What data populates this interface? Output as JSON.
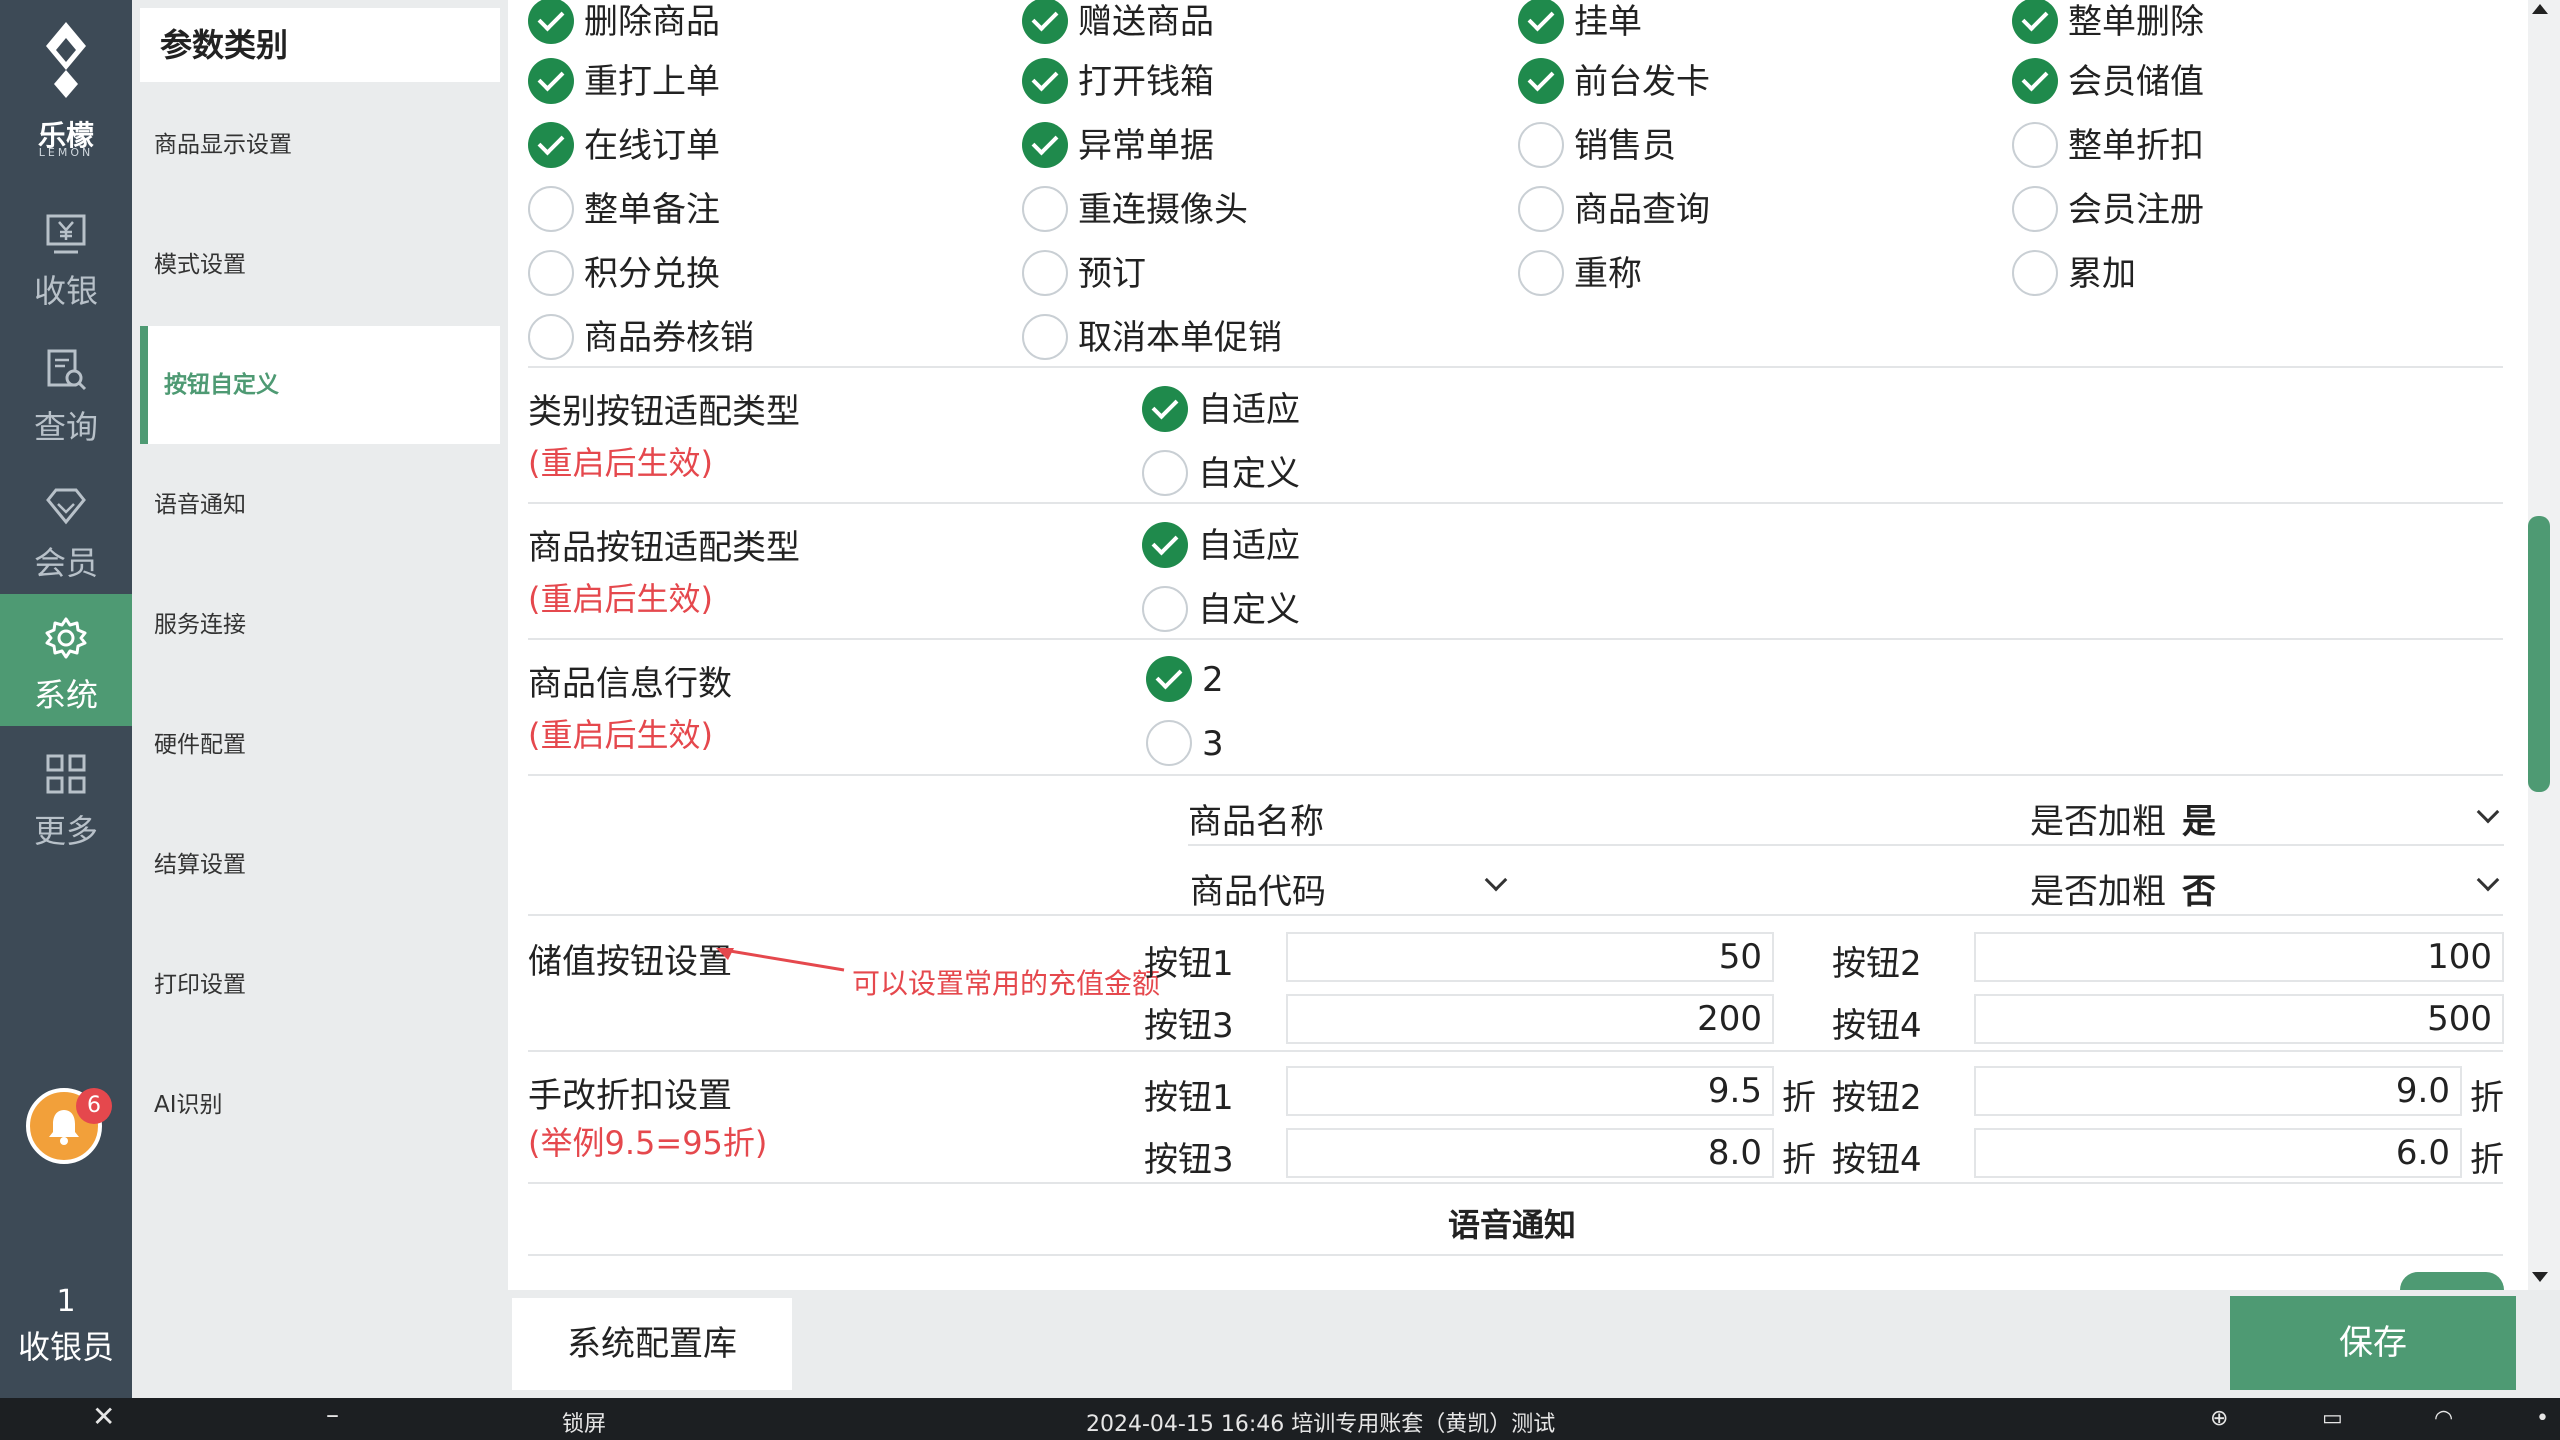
{
  "nav": {
    "logo_text": "乐檬",
    "logo_sub": "LEMON",
    "items": [
      {
        "label": "收银",
        "icon": "cash-register-icon"
      },
      {
        "label": "查询",
        "icon": "search-document-icon"
      },
      {
        "label": "会员",
        "icon": "diamond-icon"
      },
      {
        "label": "系统",
        "icon": "gear-icon"
      },
      {
        "label": "更多",
        "icon": "grid-icon"
      }
    ],
    "active": "系统",
    "bell_badge": "6",
    "cashier_num": "1",
    "cashier_label": "收银员"
  },
  "category": {
    "title": "参数类别",
    "items": [
      "商品显示设置",
      "模式设置",
      "按钮自定义",
      "语音通知",
      "服务连接",
      "硬件配置",
      "结算设置",
      "打印设置",
      "AI识别"
    ],
    "active": "按钮自定义"
  },
  "buttons": {
    "rows": [
      [
        {
          "label": "删除商品",
          "checked": true
        },
        {
          "label": "赠送商品",
          "checked": true
        },
        {
          "label": "挂单",
          "checked": true
        },
        {
          "label": "整单删除",
          "checked": true
        }
      ],
      [
        {
          "label": "重打上单",
          "checked": true
        },
        {
          "label": "打开钱箱",
          "checked": true
        },
        {
          "label": "前台发卡",
          "checked": true
        },
        {
          "label": "会员储值",
          "checked": true
        }
      ],
      [
        {
          "label": "在线订单",
          "checked": true
        },
        {
          "label": "异常单据",
          "checked": true
        },
        {
          "label": "销售员",
          "checked": false
        },
        {
          "label": "整单折扣",
          "checked": false
        }
      ],
      [
        {
          "label": "整单备注",
          "checked": false
        },
        {
          "label": "重连摄像头",
          "checked": false
        },
        {
          "label": "商品查询",
          "checked": false
        },
        {
          "label": "会员注册",
          "checked": false
        }
      ],
      [
        {
          "label": "积分兑换",
          "checked": false
        },
        {
          "label": "预订",
          "checked": false
        },
        {
          "label": "重称",
          "checked": false
        },
        {
          "label": "累加",
          "checked": false
        }
      ],
      [
        {
          "label": "商品券核销",
          "checked": false
        },
        {
          "label": "取消本单促销",
          "checked": false
        }
      ]
    ]
  },
  "category_btn_type": {
    "label": "类别按钮适配类型",
    "note": "(重启后生效)",
    "options": [
      {
        "label": "自适应",
        "checked": true
      },
      {
        "label": "自定义",
        "checked": false
      }
    ]
  },
  "goods_btn_type": {
    "label": "商品按钮适配类型",
    "note": "(重启后生效)",
    "options": [
      {
        "label": "自适应",
        "checked": true
      },
      {
        "label": "自定义",
        "checked": false
      }
    ]
  },
  "goods_info_rows": {
    "label": "商品信息行数",
    "note": "(重启后生效)",
    "options": [
      {
        "label": "2",
        "checked": true
      },
      {
        "label": "3",
        "checked": false
      }
    ]
  },
  "info_lines": [
    {
      "field": "商品名称",
      "bold_label": "是否加粗",
      "bold_value": "是"
    },
    {
      "field": "商品代码",
      "bold_label": "是否加粗",
      "bold_value": "否"
    }
  ],
  "stored_value": {
    "label": "储值按钮设置",
    "annotation": "可以设置常用的充值金额",
    "b1_label": "按钮1",
    "b1": "50",
    "b2_label": "按钮2",
    "b2": "100",
    "b3_label": "按钮3",
    "b3": "200",
    "b4_label": "按钮4",
    "b4": "500"
  },
  "discount": {
    "label": "手改折扣设置",
    "note": "(举例9.5=95折)",
    "unit": "折",
    "b1_label": "按钮1",
    "b1": "9.5",
    "b2_label": "按钮2",
    "b2": "9.0",
    "b3_label": "按钮3",
    "b3": "8.0",
    "b4_label": "按钮4",
    "b4": "6.0"
  },
  "voice_section_title": "语音通知",
  "footer": {
    "sys_btn": "系统配置库",
    "save_btn": "保存"
  },
  "taskbar": {
    "lock": "锁屏",
    "status": "2024-04-15 16:46 培训专用账套（黄凯）测试"
  },
  "colors": {
    "accent": "#4e9a73",
    "check": "#1f8a4c",
    "red": "#e5484d",
    "nav_bg": "#3d4a56"
  }
}
